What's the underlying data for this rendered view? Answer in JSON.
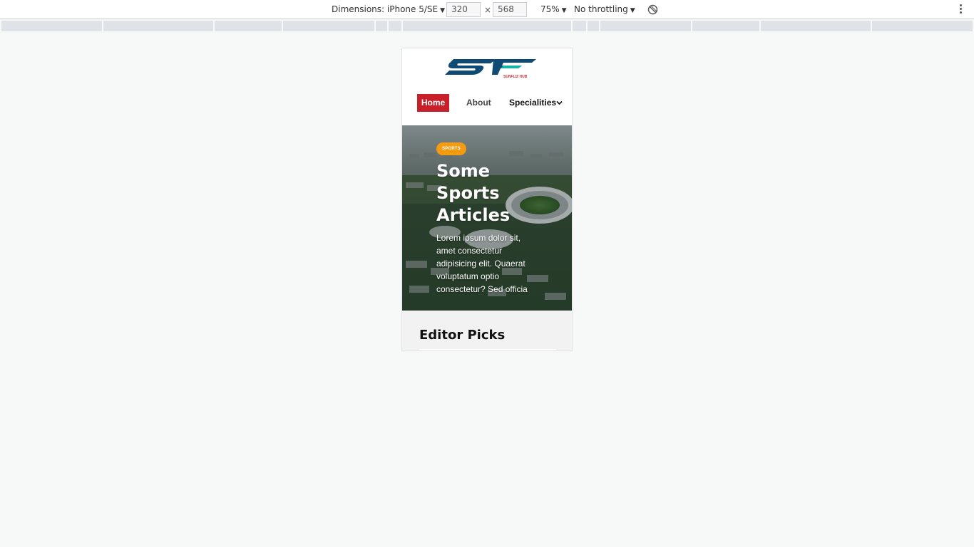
{
  "devtools": {
    "dimensions_label": "Dimensions: iPhone 5/SE",
    "width_value": "320",
    "times": "×",
    "height_value": "568",
    "zoom": "75%",
    "throttling": "No throttling"
  },
  "site": {
    "logo": {
      "letters": "SF",
      "tagline": "SUNFLIZ HUB",
      "colors": {
        "primary": "#0e4a73",
        "accent": "#17b3a7",
        "tag": "#d32f2f"
      }
    },
    "nav": {
      "home": "Home",
      "about": "About",
      "specialities": "Specialities",
      "active_color": "#c8202a"
    },
    "hero": {
      "badge": "SPORTS",
      "badge_color": "#f39c12",
      "title": "Some Sports Articles",
      "text": "Lorem ipsum dolor sit, amet consectetur adipisicing elit. Quaerat voluptatum optio consectetur? Sed officia"
    },
    "editor_picks": {
      "title": "Editor Picks"
    }
  }
}
